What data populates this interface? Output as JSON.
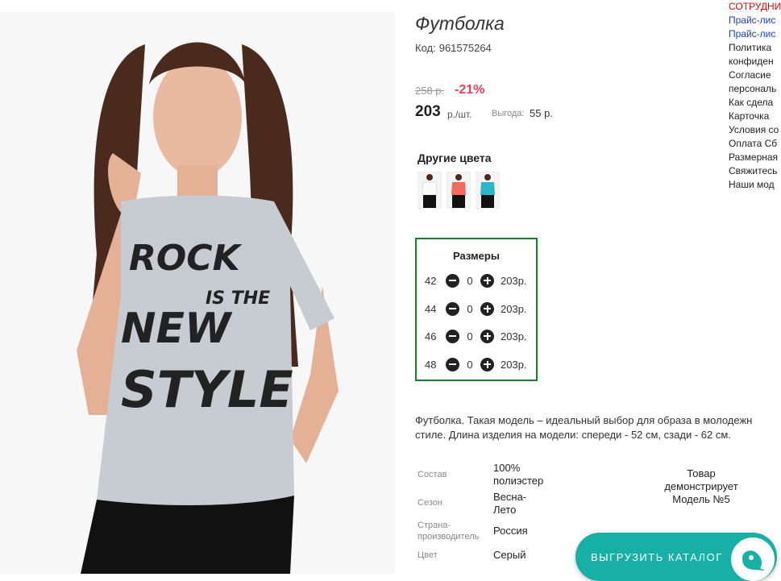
{
  "product": {
    "title": "Футболка",
    "code_label": "Код:",
    "code": "961575264",
    "old_price": "258 р.",
    "discount": "-21%",
    "price": "203",
    "price_unit": "р./шт.",
    "savings_label": "Выгода:",
    "savings_value": "55 р.",
    "print_text": [
      "ROCK",
      "IS THE",
      "NEW",
      "STYLE"
    ]
  },
  "other_colors": {
    "title": "Другие цвета",
    "swatch_colors": [
      "#ffffff",
      "#f26b5b",
      "#2bb6c9"
    ]
  },
  "sizes": {
    "title": "Размеры",
    "rows": [
      {
        "size": "42",
        "qty": "0",
        "price": "203р."
      },
      {
        "size": "44",
        "qty": "0",
        "price": "203р."
      },
      {
        "size": "46",
        "qty": "0",
        "price": "203р."
      },
      {
        "size": "48",
        "qty": "0",
        "price": "203р."
      }
    ]
  },
  "description": {
    "line1": "Футболка. Такая модель – идеальный выбор для образа в молодежн",
    "line2": "стиле. Длина изделия на модели: спереди - 52 см, сзади - 62 см."
  },
  "specs": [
    {
      "label": "Состав",
      "value_lines": [
        "100%",
        "полиэстер"
      ]
    },
    {
      "label": "Сезон",
      "value_lines": [
        "Весна-",
        "Лето"
      ]
    },
    {
      "label_lines": [
        "Страна-",
        "производитель"
      ],
      "value_lines": [
        "Россия"
      ]
    },
    {
      "label": "Цвет",
      "value_lines": [
        "Серый"
      ]
    }
  ],
  "model_note": [
    "Товар",
    "демонстрирует",
    "Модель №5"
  ],
  "side_links": [
    {
      "text": "СОТРУДНИ",
      "color": "red"
    },
    {
      "text": "Прайс-лис",
      "color": "blue"
    },
    {
      "text": "Прайс-лис",
      "color": "blue"
    },
    {
      "text": "Политика",
      "color": "dark"
    },
    {
      "text": "конфиден",
      "color": "dark"
    },
    {
      "text": "Согласие",
      "color": "dark"
    },
    {
      "text": "персональ",
      "color": "dark"
    },
    {
      "text": "Как сдела",
      "color": "dark"
    },
    {
      "text": "Карточка",
      "color": "dark"
    },
    {
      "text": "Условия со",
      "color": "dark"
    },
    {
      "text": "Оплата Сб",
      "color": "dark"
    },
    {
      "text": "Размерная",
      "color": "dark"
    },
    {
      "text": "Свяжитесь",
      "color": "dark"
    },
    {
      "text": "Наши мод",
      "color": "dark"
    }
  ],
  "export_button": {
    "label": "ВЫГРУЗИТЬ КАТАЛОГ",
    "icon": "chat-bubble-icon"
  },
  "colors": {
    "accent": "#16b0a7",
    "discount": "#e8415a",
    "sizes_border": "#1a7f2a"
  }
}
